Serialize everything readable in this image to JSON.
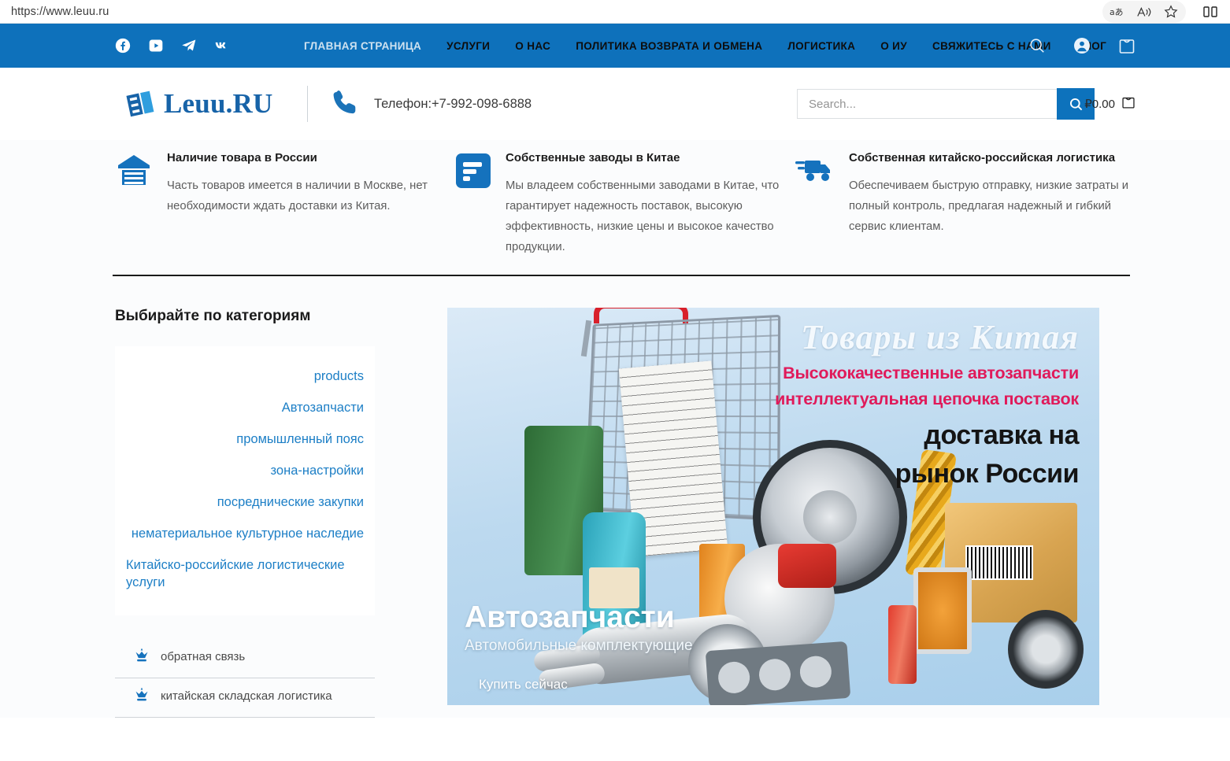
{
  "browser": {
    "url": "https://www.leuu.ru",
    "actions": [
      {
        "name": "translate-icon",
        "glyph": "aあ"
      },
      {
        "name": "read-aloud-icon",
        "glyph": "A"
      },
      {
        "name": "favorite-icon",
        "glyph": "☆"
      },
      {
        "name": "split-screen-icon",
        "glyph": "▯"
      }
    ]
  },
  "topnav": {
    "background": "#0e71bb",
    "social": [
      "facebook-icon",
      "youtube-icon",
      "telegram-icon",
      "vk-icon"
    ],
    "menu": [
      {
        "label": "ГЛАВНАЯ СТРАНИЦА",
        "active": true
      },
      {
        "label": "УСЛУГИ",
        "active": false
      },
      {
        "label": "О НАС",
        "active": false
      },
      {
        "label": "ПОЛИТИКА ВОЗВРАТА И ОБМЕНА",
        "active": false
      },
      {
        "label": "ЛОГИСТИКА",
        "active": false
      },
      {
        "label": "О ИУ",
        "active": false
      },
      {
        "label": "СВЯЖИТЕСЬ С НАМИ",
        "active": false
      },
      {
        "label": "БЛОГ",
        "active": false
      }
    ],
    "icons": [
      "search-icon",
      "account-icon",
      "cart-bag-icon"
    ]
  },
  "header": {
    "logo_text": "Leuu.RU",
    "logo_mark": "EI",
    "phone": "Телефон:+7-992-098-6888",
    "search_placeholder": "Search...",
    "search_value": "",
    "cart_amount": "₽0.00"
  },
  "features": [
    {
      "icon": "warehouse-icon",
      "title": "Наличие товара в России",
      "body": "Часть товаров имеется в наличии в Москве, нет необходимости ждать доставки из Китая."
    },
    {
      "icon": "factory-chart-icon",
      "title": "Собственные заводы в Китае",
      "body": "Мы владеем собственными заводами в Китае, что гарантирует надежность поставок, высокую эффективность, низкие цены и высокое качество продукции."
    },
    {
      "icon": "delivery-truck-icon",
      "title": "Собственная китайско-российская логистика",
      "body": "Обеспечиваем быструю отправку, низкие затраты и полный контроль, предлагая надежный и гибкий сервис клиентам."
    }
  ],
  "categories": {
    "heading": "Выбирайте по категориям",
    "items": [
      {
        "label": "products",
        "wrapped": false
      },
      {
        "label": "Автозапчасти",
        "wrapped": false
      },
      {
        "label": "промышленный пояс",
        "wrapped": false
      },
      {
        "label": "зона-настройки",
        "wrapped": false
      },
      {
        "label": "посреднические закупки",
        "wrapped": false
      },
      {
        "label": "нематериальное культурное наследие",
        "wrapped": false
      },
      {
        "label": "Китайско-российские логистические услуги",
        "wrapped": true
      }
    ],
    "link_color": "#1d7fc6"
  },
  "services": [
    {
      "icon": "crown-icon",
      "label": "обратная связь"
    },
    {
      "icon": "crown-icon",
      "label": "китайская складская логистика"
    }
  ],
  "slider": {
    "banner_lines": [
      {
        "text": "Товары из Китая",
        "color": "#f4f9fd"
      },
      {
        "text": "Высококачественные автозапчасти",
        "color": "#e01a5a"
      },
      {
        "text": "интеллектуальная цепочка поставок",
        "color": "#e01a5a"
      },
      {
        "text": "доставка на",
        "color": "#141414"
      },
      {
        "text": "рынок России",
        "color": "#141414"
      }
    ],
    "overlay_title": "Автозапчасти",
    "overlay_subtitle": "Автомобильные комплектующие",
    "overlay_cta": "Купить сейчас",
    "prev_arrow": "‹",
    "next_arrow": "›"
  }
}
